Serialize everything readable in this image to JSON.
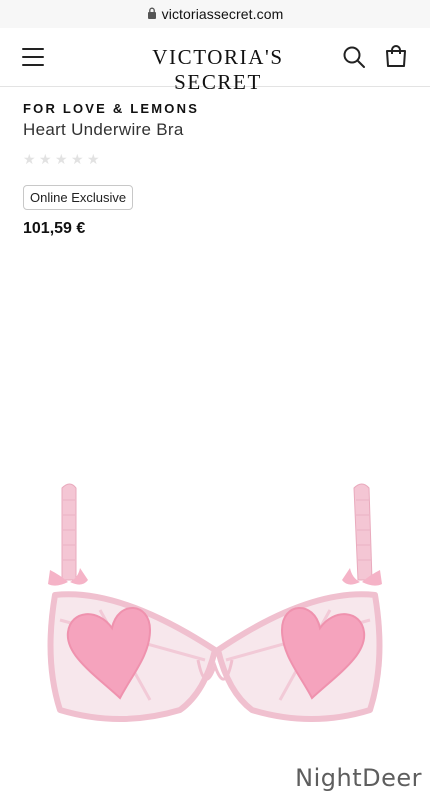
{
  "browser": {
    "url": "victoriassecret.com"
  },
  "header": {
    "brand": "VICTORIA'S SECRET"
  },
  "product": {
    "brand": "FOR LOVE & LEMONS",
    "name": "Heart Underwire Bra",
    "rating_stars": 0,
    "rating_max": 5,
    "badge": "Online Exclusive",
    "price": "101,59 €"
  },
  "image": {
    "subject": "pink heart underwire bra"
  },
  "watermark": "NightDeer",
  "colors": {
    "bra_pink": "#f4c6d4",
    "heart_pink": "#f5a3bd",
    "star_empty": "#e2e2e2",
    "badge_border": "#c8c8c8"
  }
}
